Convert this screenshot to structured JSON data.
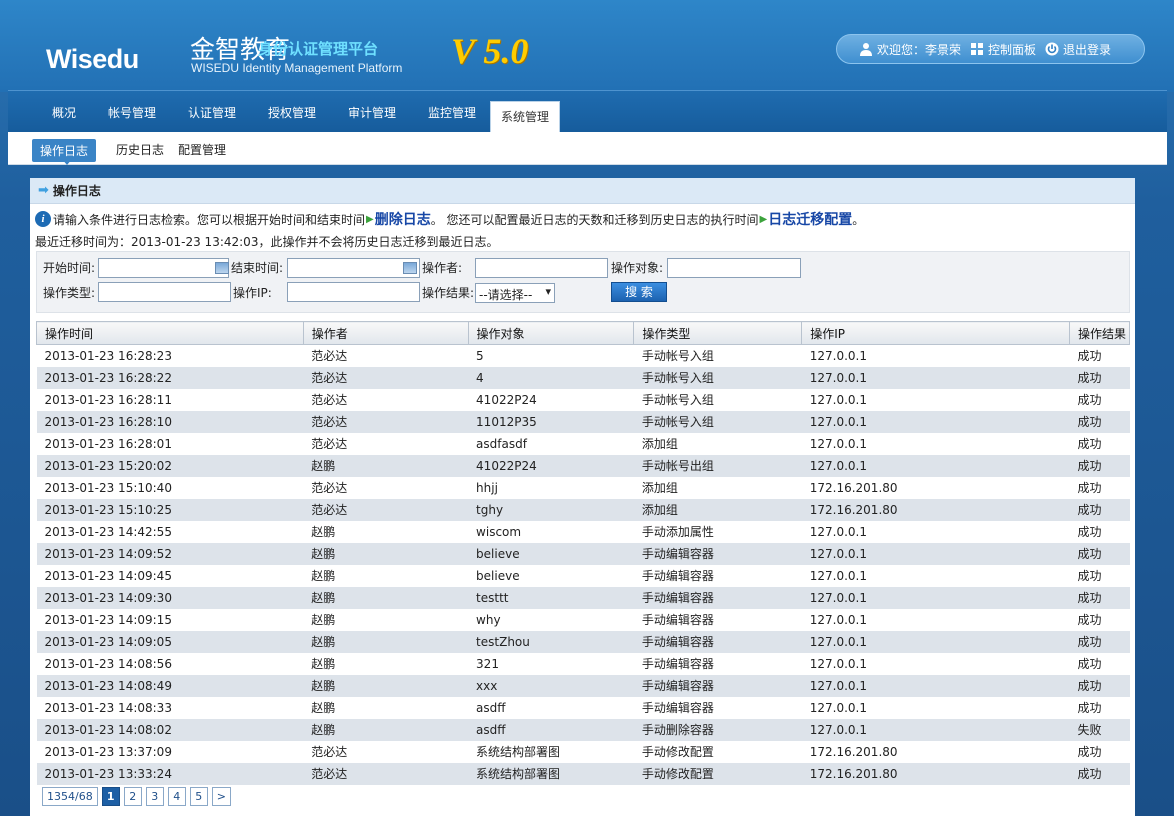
{
  "header": {
    "logo_text": "Wisedu",
    "title_cn": "金智教育",
    "title_sub": "身份认证管理平台",
    "title_en": "WISEDU Identity Management Platform",
    "version": "V 5.0",
    "welcome": "欢迎您：李景荣",
    "control_panel": "控制面板",
    "logout": "退出登录"
  },
  "nav": {
    "tabs": [
      "概况",
      "帐号管理",
      "认证管理",
      "授权管理",
      "审计管理",
      "监控管理",
      "系统管理"
    ],
    "active": "系统管理"
  },
  "subnav": {
    "tabs": [
      "操作日志",
      "历史日志",
      "配置管理"
    ],
    "active": "操作日志"
  },
  "section": {
    "title": "操作日志",
    "info_part1": "请输入条件进行日志检索。您可以根据开始时间和结束时间",
    "delete_link": "删除日志",
    "info_part2": "。 您还可以配置最近日志的天数和迁移到历史日志的执行时间",
    "migrate_link": "日志迁移配置",
    "info_part3": "。",
    "last_migrate": "最近迁移时间为：2013-01-23 13:42:03，此操作并不会将历史日志迁移到最近日志。"
  },
  "filter": {
    "start_time_label": "开始时间:",
    "end_time_label": "结束时间:",
    "operator_label": "操作者:",
    "target_label": "操作对象:",
    "type_label": "操作类型:",
    "ip_label": "操作IP:",
    "result_label": "操作结果:",
    "result_selected": "--请选择--",
    "search_label": "搜 索"
  },
  "table": {
    "headers": [
      "操作时间",
      "操作者",
      "操作对象",
      "操作类型",
      "操作IP",
      "操作结果"
    ],
    "rows": [
      [
        "2013-01-23 16:28:23",
        "范必达",
        "5",
        "手动帐号入组",
        "127.0.0.1",
        "成功"
      ],
      [
        "2013-01-23 16:28:22",
        "范必达",
        "4",
        "手动帐号入组",
        "127.0.0.1",
        "成功"
      ],
      [
        "2013-01-23 16:28:11",
        "范必达",
        "41022P24",
        "手动帐号入组",
        "127.0.0.1",
        "成功"
      ],
      [
        "2013-01-23 16:28:10",
        "范必达",
        "11012P35",
        "手动帐号入组",
        "127.0.0.1",
        "成功"
      ],
      [
        "2013-01-23 16:28:01",
        "范必达",
        "asdfasdf",
        "添加组",
        "127.0.0.1",
        "成功"
      ],
      [
        "2013-01-23 15:20:02",
        "赵鹏",
        "41022P24",
        "手动帐号出组",
        "127.0.0.1",
        "成功"
      ],
      [
        "2013-01-23 15:10:40",
        "范必达",
        "hhjj",
        "添加组",
        "172.16.201.80",
        "成功"
      ],
      [
        "2013-01-23 15:10:25",
        "范必达",
        "tghy",
        "添加组",
        "172.16.201.80",
        "成功"
      ],
      [
        "2013-01-23 14:42:55",
        "赵鹏",
        "wiscom",
        "手动添加属性",
        "127.0.0.1",
        "成功"
      ],
      [
        "2013-01-23 14:09:52",
        "赵鹏",
        "believe",
        "手动编辑容器",
        "127.0.0.1",
        "成功"
      ],
      [
        "2013-01-23 14:09:45",
        "赵鹏",
        "believe",
        "手动编辑容器",
        "127.0.0.1",
        "成功"
      ],
      [
        "2013-01-23 14:09:30",
        "赵鹏",
        "testtt",
        "手动编辑容器",
        "127.0.0.1",
        "成功"
      ],
      [
        "2013-01-23 14:09:15",
        "赵鹏",
        "why",
        "手动编辑容器",
        "127.0.0.1",
        "成功"
      ],
      [
        "2013-01-23 14:09:05",
        "赵鹏",
        "testZhou",
        "手动编辑容器",
        "127.0.0.1",
        "成功"
      ],
      [
        "2013-01-23 14:08:56",
        "赵鹏",
        "321",
        "手动编辑容器",
        "127.0.0.1",
        "成功"
      ],
      [
        "2013-01-23 14:08:49",
        "赵鹏",
        "xxx",
        "手动编辑容器",
        "127.0.0.1",
        "成功"
      ],
      [
        "2013-01-23 14:08:33",
        "赵鹏",
        "asdff",
        "手动编辑容器",
        "127.0.0.1",
        "成功"
      ],
      [
        "2013-01-23 14:08:02",
        "赵鹏",
        "asdff",
        "手动删除容器",
        "127.0.0.1",
        "失败"
      ],
      [
        "2013-01-23 13:37:09",
        "范必达",
        "系统结构部署图",
        "手动修改配置",
        "172.16.201.80",
        "成功"
      ],
      [
        "2013-01-23 13:33:24",
        "范必达",
        "系统结构部署图",
        "手动修改配置",
        "172.16.201.80",
        "成功"
      ]
    ]
  },
  "pager": {
    "summary": "1354/68",
    "pages": [
      "1",
      "2",
      "3",
      "4",
      "5"
    ],
    "next": ">",
    "current": "1"
  }
}
